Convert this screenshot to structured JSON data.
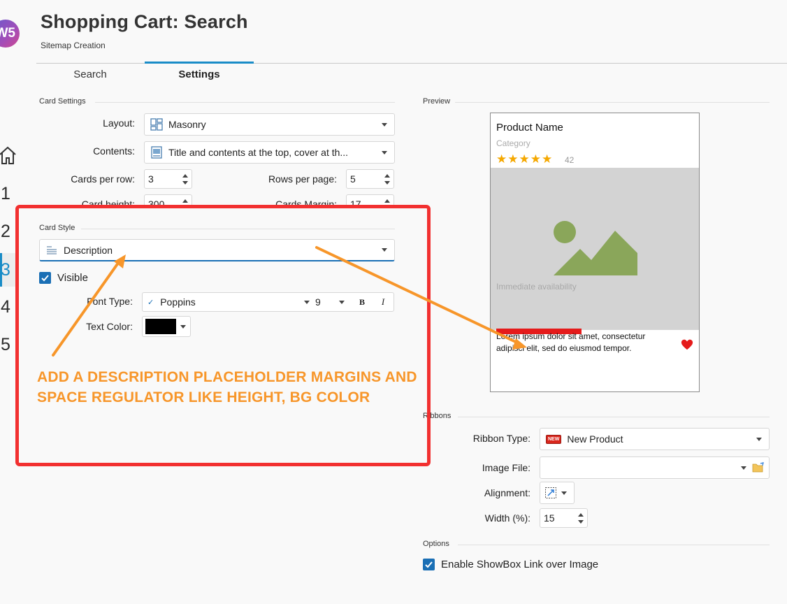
{
  "header": {
    "title": "Shopping Cart: Search",
    "subtitle": "Sitemap Creation"
  },
  "rail": {
    "logo": "W5",
    "steps": [
      "1",
      "2",
      "3",
      "4",
      "5"
    ],
    "active_step": "3"
  },
  "tabs": [
    {
      "label": "Search"
    },
    {
      "label": "Settings"
    }
  ],
  "card_settings": {
    "section": "Card Settings",
    "layout": {
      "label": "Layout:",
      "value": "Masonry"
    },
    "contents": {
      "label": "Contents:",
      "value": "Title and contents at the top, cover at th..."
    },
    "cards_per_row": {
      "label": "Cards per row:",
      "value": "3"
    },
    "rows_per_page": {
      "label": "Rows per page:",
      "value": "5"
    },
    "card_height": {
      "label": "Card height:",
      "value": "300"
    },
    "cards_margin": {
      "label": "Cards Margin:",
      "value": "17"
    }
  },
  "card_style": {
    "section": "Card Style",
    "element": "Description",
    "visible_label": "Visible",
    "font_type": {
      "label": "Font Type:",
      "font": "Poppins",
      "size": "9",
      "bold": "B",
      "italic": "I"
    },
    "text_color": {
      "label": "Text Color:",
      "value": "#000000"
    }
  },
  "preview": {
    "section": "Preview",
    "product_name": "Product Name",
    "category": "Category",
    "stars": "★★★★★",
    "rating_count": "42",
    "availability": "Immediate availability",
    "description": "Lorem ipsum dolor sit amet, consectetur adipisci elit, sed do eiusmod tempor."
  },
  "ribbons": {
    "section": "Ribbons",
    "ribbon_type": {
      "label": "Ribbon Type:",
      "value": "New Product",
      "badge": "NEW"
    },
    "image_file": {
      "label": "Image File:",
      "value": ""
    },
    "alignment": {
      "label": "Alignment:"
    },
    "width": {
      "label": "Width (%):",
      "value": "15"
    }
  },
  "options": {
    "section": "Options",
    "showbox_label": "Enable ShowBox Link over Image"
  },
  "annotation": {
    "text": "ADD A DESCRIPTION PLACEHOLDER MARGINS AND SPACE REGULATOR LIKE HEIGHT, BG COLOR"
  },
  "colors": {
    "accent": "#1a8cc7",
    "annotation_box": "#f23030",
    "annotation_text": "#f7962a",
    "star": "#f5a800",
    "placeholder_green": "#8aa65a",
    "heart": "#e51b1b"
  }
}
